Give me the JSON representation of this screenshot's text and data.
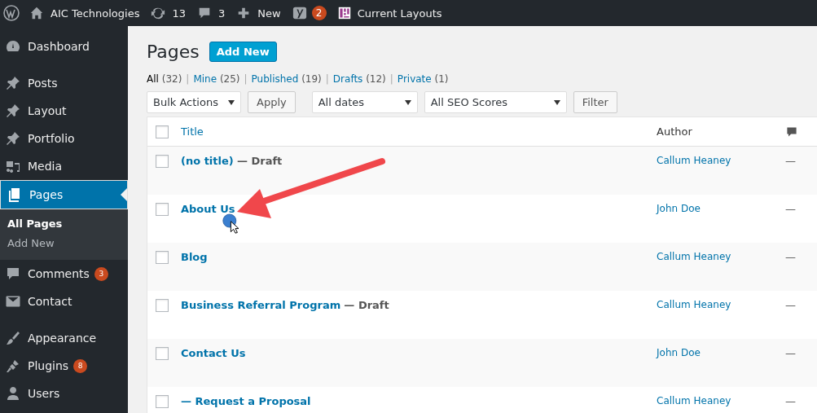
{
  "admin_bar": {
    "site": "AIC Technologies",
    "updates": "13",
    "comments": "3",
    "new": "New",
    "seo_badge": "2",
    "layouts": "Current Layouts"
  },
  "sidebar": {
    "groups": [
      {
        "items": [
          {
            "label": "Dashboard",
            "selected": false
          }
        ]
      },
      {
        "items": [
          {
            "label": "Posts",
            "selected": false
          },
          {
            "label": "Layout",
            "selected": false
          },
          {
            "label": "Portfolio",
            "selected": false
          },
          {
            "label": "Media",
            "selected": false
          },
          {
            "label": "Pages",
            "selected": true,
            "children": [
              {
                "label": "All Pages",
                "selected": true
              },
              {
                "label": "Add New",
                "selected": false
              }
            ]
          },
          {
            "label": "Comments",
            "selected": false,
            "badge": "3"
          },
          {
            "label": "Contact",
            "selected": false
          }
        ]
      },
      {
        "items": [
          {
            "label": "Appearance",
            "selected": false
          },
          {
            "label": "Plugins",
            "selected": false,
            "badge": "8"
          },
          {
            "label": "Users",
            "selected": false
          }
        ]
      }
    ]
  },
  "page": {
    "title": "Pages",
    "add_new": "Add New",
    "views": [
      {
        "label": "All",
        "count": "(32)",
        "selected": true
      },
      {
        "separator": "|",
        "label": "Mine",
        "count": "(25)",
        "selected": false
      },
      {
        "separator": "|",
        "label": "Published",
        "count": "(19)",
        "selected": false
      },
      {
        "separator": "|",
        "label": "Drafts",
        "count": "(12)",
        "selected": false
      },
      {
        "separator": "|",
        "label": "Private",
        "count": "(1)",
        "selected": false
      }
    ],
    "bulk_actions": "Bulk Actions",
    "apply": "Apply",
    "dates": "All dates",
    "seo_scores": "All SEO Scores",
    "filter": "Filter"
  },
  "table": {
    "columns": [
      "Title",
      "Author"
    ],
    "select_all_checked": false,
    "rows": [
      {
        "checked": false,
        "title": "(no title)",
        "state": "— Draft",
        "author": "Callum Heaney",
        "comments": "—"
      },
      {
        "checked": false,
        "title": "About Us",
        "author": "John Doe",
        "comments": "—"
      },
      {
        "checked": false,
        "title": "Blog",
        "author": "Callum Heaney",
        "comments": "—"
      },
      {
        "checked": false,
        "title": "Business Referral Program",
        "state": "— Draft",
        "author": "Callum Heaney",
        "comments": "—"
      },
      {
        "checked": false,
        "title": "Contact Us",
        "author": "John Doe",
        "comments": "—"
      },
      {
        "checked": false,
        "title": "— Request a Proposal",
        "author": "Callum Heaney",
        "comments": "—"
      }
    ]
  }
}
